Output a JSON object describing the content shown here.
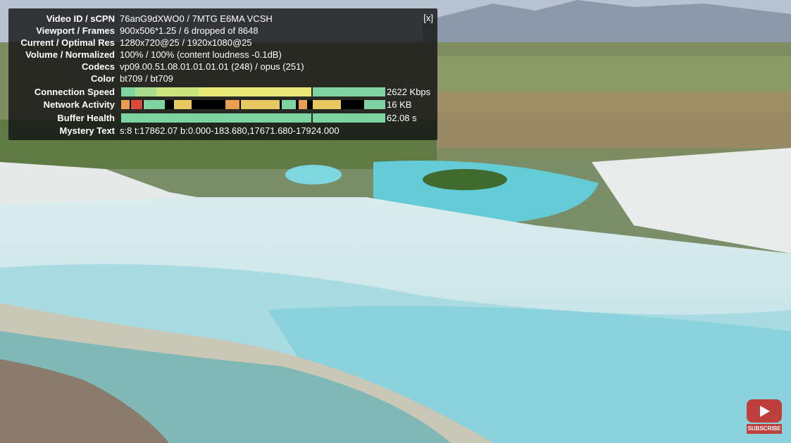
{
  "stats": {
    "close_label": "[x]",
    "rows": [
      {
        "label": "Video ID / sCPN",
        "value": "76anG9dXWO0 / 7MTG E6MA VCSH"
      },
      {
        "label": "Viewport / Frames",
        "value": "900x506*1.25 / 6 dropped of 8648"
      },
      {
        "label": "Current / Optimal Res",
        "value": "1280x720@25 / 1920x1080@25"
      },
      {
        "label": "Volume / Normalized",
        "value": "100% / 100% (content loudness -0.1dB)"
      },
      {
        "label": "Codecs",
        "value": "vp09.00.51.08.01.01.01.01 (248) / opus (251)"
      },
      {
        "label": "Color",
        "value": "bt709 / bt709"
      }
    ],
    "bars": [
      {
        "label": "Connection Speed",
        "value": "2622 Kbps"
      },
      {
        "label": "Network Activity",
        "value": "16 KB"
      },
      {
        "label": "Buffer Health",
        "value": "62.08 s"
      }
    ],
    "mystery": {
      "label": "Mystery Text",
      "value": "s:8 t:17862.07 b:0.000-183.680,17671.680-17924.000"
    }
  },
  "subscribe": {
    "label": "SUBSCRIBE"
  },
  "colors": {
    "overlay": "#141414",
    "bar_green": "#7fd3a0",
    "bar_yellow": "#e8e878",
    "subscribe_red": "#c4302b"
  }
}
